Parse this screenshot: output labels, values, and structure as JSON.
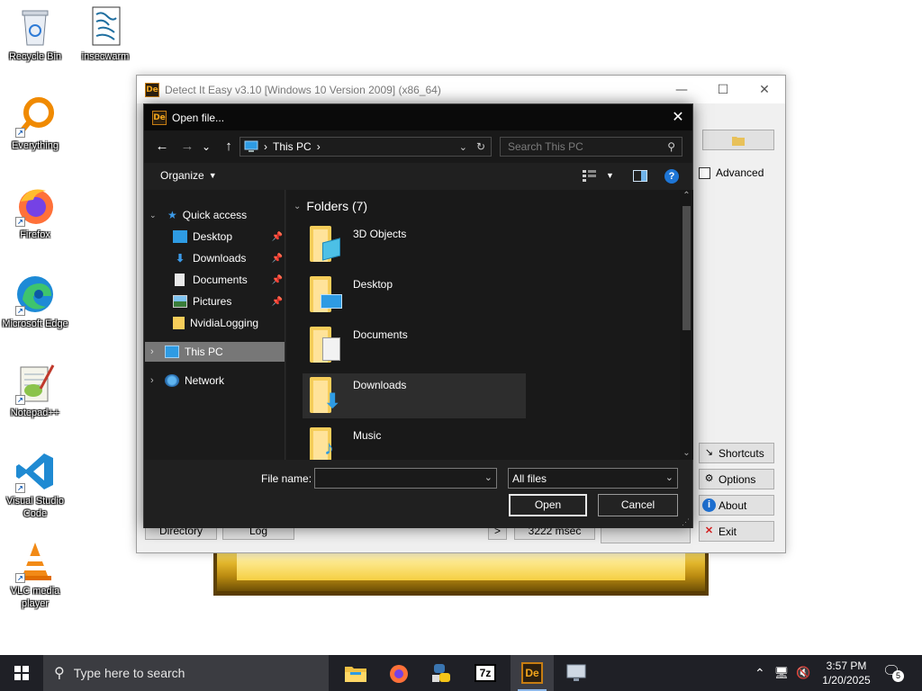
{
  "desktop": {
    "icons": [
      {
        "label": "Recycle Bin"
      },
      {
        "label": "insecwarm"
      },
      {
        "label": "Everything"
      },
      {
        "label": "Firefox"
      },
      {
        "label": "Microsoft Edge"
      },
      {
        "label": "Notepad++"
      },
      {
        "label": "Visual Studio Code"
      },
      {
        "label": "VLC media player"
      }
    ]
  },
  "die_window": {
    "title": "Detect It Easy v3.10 [Windows 10 Version 2009] (x86_64)",
    "controls": {
      "minimize": "—",
      "maximize": "☐",
      "close": "✕"
    },
    "advanced_label": "Advanced",
    "side_buttons": {
      "shortcuts": "Shortcuts",
      "options": "Options",
      "about": "About",
      "exit": "Exit"
    },
    "bottom": {
      "directory": "Directory",
      "log": "Log",
      "arrow": ">",
      "time": "3222 msec"
    }
  },
  "open_dialog": {
    "title": "Open file...",
    "close": "✕",
    "nav": {
      "back": "←",
      "forward": "→",
      "recent": "⌄",
      "up": "↑"
    },
    "breadcrumb": {
      "sep1": "›",
      "location": "This PC",
      "sep2": "›"
    },
    "search_placeholder": "Search This PC",
    "organize": "Organize",
    "tree": {
      "quick_access": "Quick access",
      "desktop": "Desktop",
      "downloads": "Downloads",
      "documents": "Documents",
      "pictures": "Pictures",
      "nvidia": "NvidiaLogging",
      "this_pc": "This PC",
      "network": "Network"
    },
    "folders_header": "Folders (7)",
    "folders": [
      {
        "name": "3D Objects"
      },
      {
        "name": "Desktop"
      },
      {
        "name": "Documents"
      },
      {
        "name": "Downloads"
      },
      {
        "name": "Music"
      }
    ],
    "file_name_label": "File name:",
    "file_name_value": "",
    "filter": "All files",
    "open_button": "Open",
    "cancel_button": "Cancel"
  },
  "taskbar": {
    "search_placeholder": "Type here to search",
    "time": "3:57 PM",
    "date": "1/20/2025",
    "notifications": "5"
  }
}
